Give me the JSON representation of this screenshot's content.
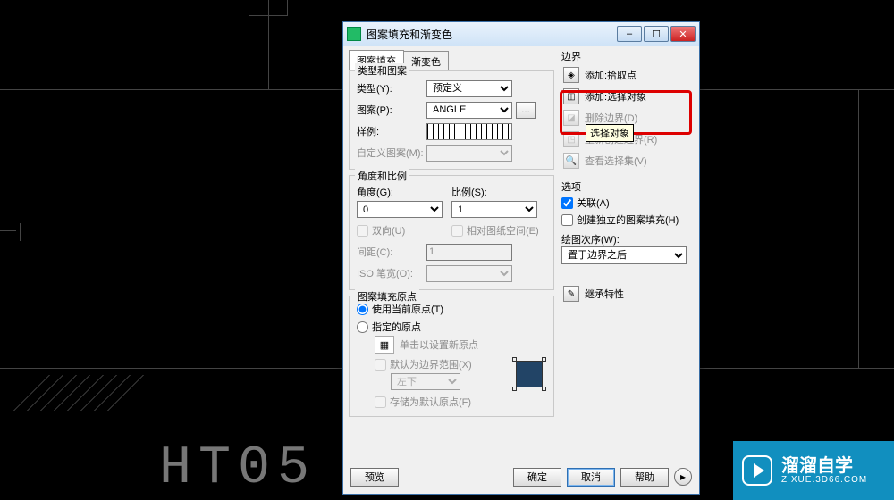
{
  "cad_label": "HT05",
  "dialog": {
    "title": "图案填充和渐变色",
    "tabs": {
      "hatch": "图案填充",
      "gradient": "渐变色"
    },
    "group_type": {
      "title": "类型和图案",
      "type_label": "类型(Y):",
      "type_value": "预定义",
      "pattern_label": "图案(P):",
      "pattern_value": "ANGLE",
      "swatch_label": "样例:",
      "custom_label": "自定义图案(M):"
    },
    "group_angle": {
      "title": "角度和比例",
      "angle_label": "角度(G):",
      "angle_value": "0",
      "scale_label": "比例(S):",
      "scale_value": "1",
      "twoway_label": "双向(U)",
      "paperspace_label": "相对图纸空间(E)",
      "spacing_label": "间距(C):",
      "spacing_value": "1",
      "iso_label": "ISO 笔宽(O):"
    },
    "group_origin": {
      "title": "图案填充原点",
      "use_current": "使用当前原点(T)",
      "specified": "指定的原点",
      "click_set": "单击以设置新原点",
      "default_extent": "默认为边界范围(X)",
      "extent_value": "左下",
      "store_default": "存储为默认原点(F)"
    },
    "right": {
      "boundaries_title": "边界",
      "add_pick": "添加:拾取点",
      "add_select": "添加:选择对象",
      "tooltip": "选择对象",
      "remove": "删除边界(D)",
      "recreate": "重新创建边界(R)",
      "viewsel": "查看选择集(V)",
      "options_title": "选项",
      "assoc": "关联(A)",
      "separate": "创建独立的图案填充(H)",
      "draworder_label": "绘图次序(W):",
      "draworder_value": "置于边界之后",
      "inherit": "继承特性"
    },
    "buttons": {
      "preview": "预览",
      "ok": "确定",
      "cancel": "取消",
      "help": "帮助"
    }
  },
  "watermark": {
    "brand": "溜溜自学",
    "url": "ZIXUE.3D66.COM"
  }
}
